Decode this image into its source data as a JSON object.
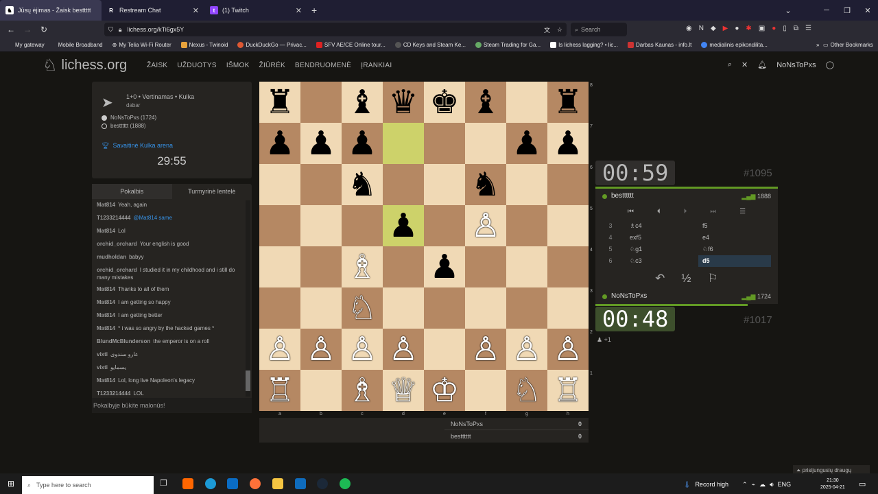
{
  "browser": {
    "tabs": [
      {
        "label": "Jūsų ėjimas - Žaisk bestttttt",
        "active": true,
        "icon": "lichess-icon"
      },
      {
        "label": "Restream Chat",
        "active": false,
        "icon": "restream-icon"
      },
      {
        "label": "(1) Twitch",
        "active": false,
        "icon": "twitch-icon"
      }
    ],
    "url": "lichess.org/kTi6gx5Y",
    "search_placeholder": "Search",
    "bookmarks": [
      "My gateway",
      "Mobile Broadband",
      "My Telia Wi-Fi Router",
      "Nexus - Twinoid",
      "DuckDuckGo — Privac...",
      "SFV AE/CE Online tour...",
      "CD Keys and Steam Ke...",
      "Steam Trading for Ga...",
      "Is lichess lagging? • lic...",
      "Darbas Kaunas - info.lt",
      "medialinis epikondilita..."
    ],
    "other_bookmarks": "Other Bookmarks"
  },
  "site": {
    "logo": "lichess.org",
    "nav": [
      "ŽAISK",
      "UŽDUOTYS",
      "IŠMOK",
      "ŽIŪRĖK",
      "BENDRUOMENĖ",
      "ĮRANKIAI"
    ],
    "username": "NoNsToPxs"
  },
  "game": {
    "mode": "1+0 • Vertinamas • Kulka",
    "time_ago": "dabar",
    "white_player": "NoNsToPxs (1724)",
    "black_player": "bestttttt (1888)",
    "arena": "Savaitinė Kulka arena",
    "arena_timer": "29:55"
  },
  "chat": {
    "tab_chat": "Pokalbis",
    "tab_standings": "Turmyrinė lentelė",
    "messages": [
      {
        "user": "Mat814",
        "text": "Yeah, again"
      },
      {
        "user": "T1233214444",
        "text": "@Mat814 same"
      },
      {
        "user": "Mat814",
        "text": "Lol"
      },
      {
        "user": "orchid_orchard",
        "text": "Your english is good"
      },
      {
        "user": "mudholdan",
        "text": "babyy"
      },
      {
        "user": "orchid_orchard",
        "text": "I studied it in my childhood and i still do many mistakes"
      },
      {
        "user": "Mat814",
        "text": "Thanks to all of them"
      },
      {
        "user": "Mat814",
        "text": "I am getting so happy"
      },
      {
        "user": "Mat814",
        "text": "I am getting better"
      },
      {
        "user": "Mat814",
        "text": "* i was so angry by the hacked games *"
      },
      {
        "user": "BlundMcBlunderson",
        "text": "the emperor is on a roll"
      },
      {
        "user": "vixti",
        "text": "عارو سندوی"
      },
      {
        "user": "vixti",
        "text": "يسمايو"
      },
      {
        "user": "Mat814",
        "text": "Lol, long live Napoleon's legacy"
      },
      {
        "user": "T1233214444",
        "text": "LOL"
      }
    ],
    "input_placeholder": "Pokalbyje būkite malonūs!"
  },
  "board": {
    "rows": [
      [
        "♜",
        "",
        "♝",
        "♛",
        "♚",
        "♝",
        "",
        "♜"
      ],
      [
        "♟",
        "♟",
        "♟",
        "",
        "",
        "",
        "♟",
        "♟"
      ],
      [
        "",
        "",
        "♞",
        "",
        "",
        "♞",
        "",
        ""
      ],
      [
        "",
        "",
        "",
        "♟",
        "",
        "♙",
        "",
        ""
      ],
      [
        "",
        "",
        "♗",
        "",
        "♟",
        "",
        "",
        ""
      ],
      [
        "",
        "",
        "♘",
        "",
        "",
        "",
        "",
        ""
      ],
      [
        "♙",
        "♙",
        "♙",
        "♙",
        "",
        "♙",
        "♙",
        "♙"
      ],
      [
        "♖",
        "",
        "♗",
        "♕",
        "♔",
        "",
        "♘",
        "♖"
      ]
    ],
    "colors": [
      [
        "b",
        "b",
        "b",
        "b",
        "b",
        "b",
        "",
        "b"
      ],
      [
        "b",
        "b",
        "b",
        "",
        "",
        "",
        "b",
        "b"
      ],
      [
        "",
        "",
        "b",
        "",
        "",
        "b",
        "",
        ""
      ],
      [
        "",
        "",
        "",
        "b",
        "",
        "w",
        "",
        ""
      ],
      [
        "",
        "",
        "w",
        "",
        "b",
        "",
        "",
        ""
      ],
      [
        "",
        "",
        "w",
        "",
        "",
        "",
        "",
        ""
      ],
      [
        "w",
        "w",
        "w",
        "w",
        "",
        "w",
        "w",
        "w"
      ],
      [
        "w",
        "",
        "w",
        "w",
        "w",
        "",
        "w",
        "w"
      ]
    ],
    "files": [
      "a",
      "b",
      "c",
      "d",
      "e",
      "f",
      "g",
      "h"
    ],
    "ranks": [
      "8",
      "7",
      "6",
      "5",
      "4",
      "3",
      "2",
      "1"
    ]
  },
  "score": {
    "p1": "NoNsToPxs",
    "p1_score": "0",
    "p2": "bestttttt",
    "p2_score": "0"
  },
  "top_clock": {
    "time": "00:59",
    "rating_rank": "#1095",
    "player": "bestttttt",
    "rating": "1888"
  },
  "bottom_clock": {
    "time": "00:48",
    "rating_rank": "#1017",
    "player": "NoNsToPxs",
    "rating": "1724"
  },
  "moves": [
    {
      "n": "3",
      "w": "♗c4",
      "b": "f5"
    },
    {
      "n": "4",
      "w": "exf5",
      "b": "e4"
    },
    {
      "n": "5",
      "w": "♘g1",
      "b": "♘f6"
    },
    {
      "n": "6",
      "w": "♘c3",
      "b": "d5"
    }
  ],
  "draw_label": "½",
  "spectators": "+1",
  "friends": "prisijungusių draugų",
  "taskbar": {
    "search": "Type here to search",
    "record": "Record high",
    "lang": "ENG",
    "time": "21:30",
    "date": "2025-04-21"
  }
}
